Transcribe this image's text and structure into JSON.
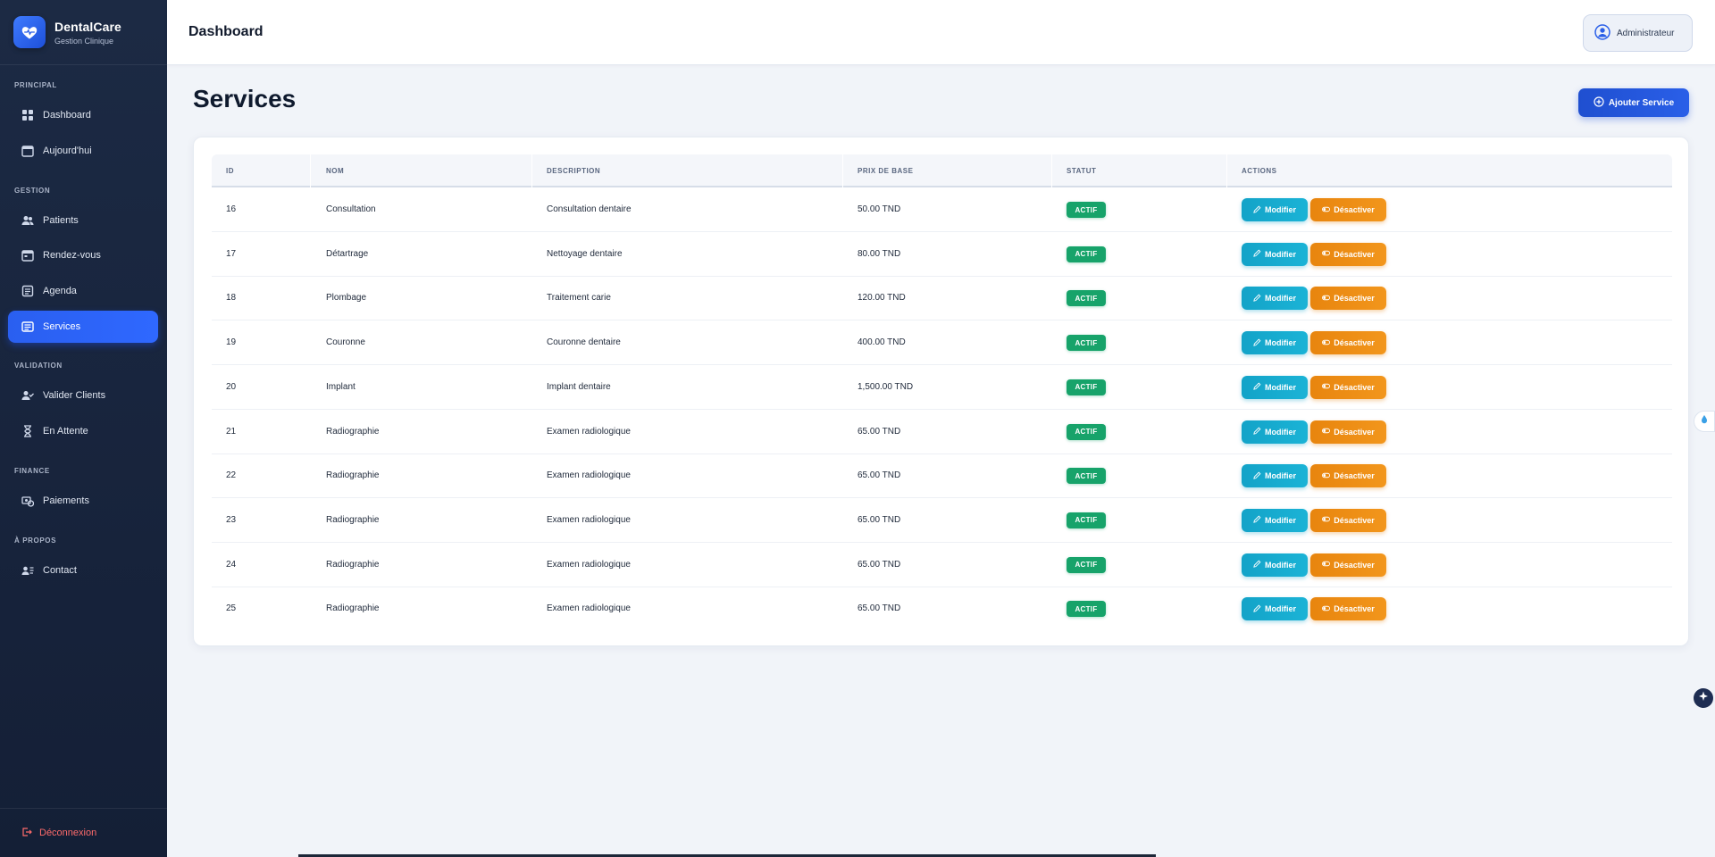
{
  "brand": {
    "name": "DentalCare",
    "subtitle": "Gestion Clinique"
  },
  "sidebar": {
    "sections": [
      {
        "title": "PRINCIPAL",
        "items": [
          {
            "label": "Dashboard",
            "icon": "grid-icon"
          },
          {
            "label": "Aujourd'hui",
            "icon": "calendar-icon"
          }
        ]
      },
      {
        "title": "GESTION",
        "items": [
          {
            "label": "Patients",
            "icon": "users-icon"
          },
          {
            "label": "Rendez-vous",
            "icon": "calendar-check-icon"
          },
          {
            "label": "Agenda",
            "icon": "agenda-icon"
          },
          {
            "label": "Services",
            "icon": "list-icon",
            "active": true
          }
        ]
      },
      {
        "title": "VALIDATION",
        "items": [
          {
            "label": "Valider Clients",
            "icon": "user-check-icon"
          },
          {
            "label": "En Attente",
            "icon": "hourglass-icon"
          }
        ]
      },
      {
        "title": "FINANCE",
        "items": [
          {
            "label": "Paiements",
            "icon": "money-icon"
          }
        ]
      },
      {
        "title": "À PROPOS",
        "items": [
          {
            "label": "Contact",
            "icon": "contact-icon"
          }
        ]
      }
    ],
    "logout_label": "Déconnexion"
  },
  "header": {
    "title": "Dashboard",
    "user_label": "Administrateur"
  },
  "main": {
    "title": "Services",
    "add_button": "Ajouter Service",
    "table": {
      "columns": [
        "ID",
        "NOM",
        "DESCRIPTION",
        "PRIX DE BASE",
        "STATUT",
        "ACTIONS"
      ],
      "rows": [
        {
          "id": "16",
          "nom": "Consultation",
          "description": "Consultation dentaire",
          "prix": "50.00 TND",
          "statut": "ACTIF"
        },
        {
          "id": "17",
          "nom": "Détartrage",
          "description": "Nettoyage dentaire",
          "prix": "80.00 TND",
          "statut": "ACTIF"
        },
        {
          "id": "18",
          "nom": "Plombage",
          "description": "Traitement carie",
          "prix": "120.00 TND",
          "statut": "ACTIF"
        },
        {
          "id": "19",
          "nom": "Couronne",
          "description": "Couronne dentaire",
          "prix": "400.00 TND",
          "statut": "ACTIF"
        },
        {
          "id": "20",
          "nom": "Implant",
          "description": "Implant dentaire",
          "prix": "1,500.00 TND",
          "statut": "ACTIF"
        },
        {
          "id": "21",
          "nom": "Radiographie",
          "description": "Examen radiologique",
          "prix": "65.00 TND",
          "statut": "ACTIF"
        },
        {
          "id": "22",
          "nom": "Radiographie",
          "description": "Examen radiologique",
          "prix": "65.00 TND",
          "statut": "ACTIF"
        },
        {
          "id": "23",
          "nom": "Radiographie",
          "description": "Examen radiologique",
          "prix": "65.00 TND",
          "statut": "ACTIF"
        },
        {
          "id": "24",
          "nom": "Radiographie",
          "description": "Examen radiologique",
          "prix": "65.00 TND",
          "statut": "ACTIF"
        },
        {
          "id": "25",
          "nom": "Radiographie",
          "description": "Examen radiologique",
          "prix": "65.00 TND",
          "statut": "ACTIF"
        }
      ],
      "action_labels": {
        "edit": "Modifier",
        "deactivate": "Désactiver"
      }
    }
  },
  "colors": {
    "accent": "#2a5fe8",
    "status_active": "#17a36a",
    "edit": "#13a3c8",
    "deactivate": "#e8850e",
    "sidebar_bg": "#1c2a44"
  }
}
